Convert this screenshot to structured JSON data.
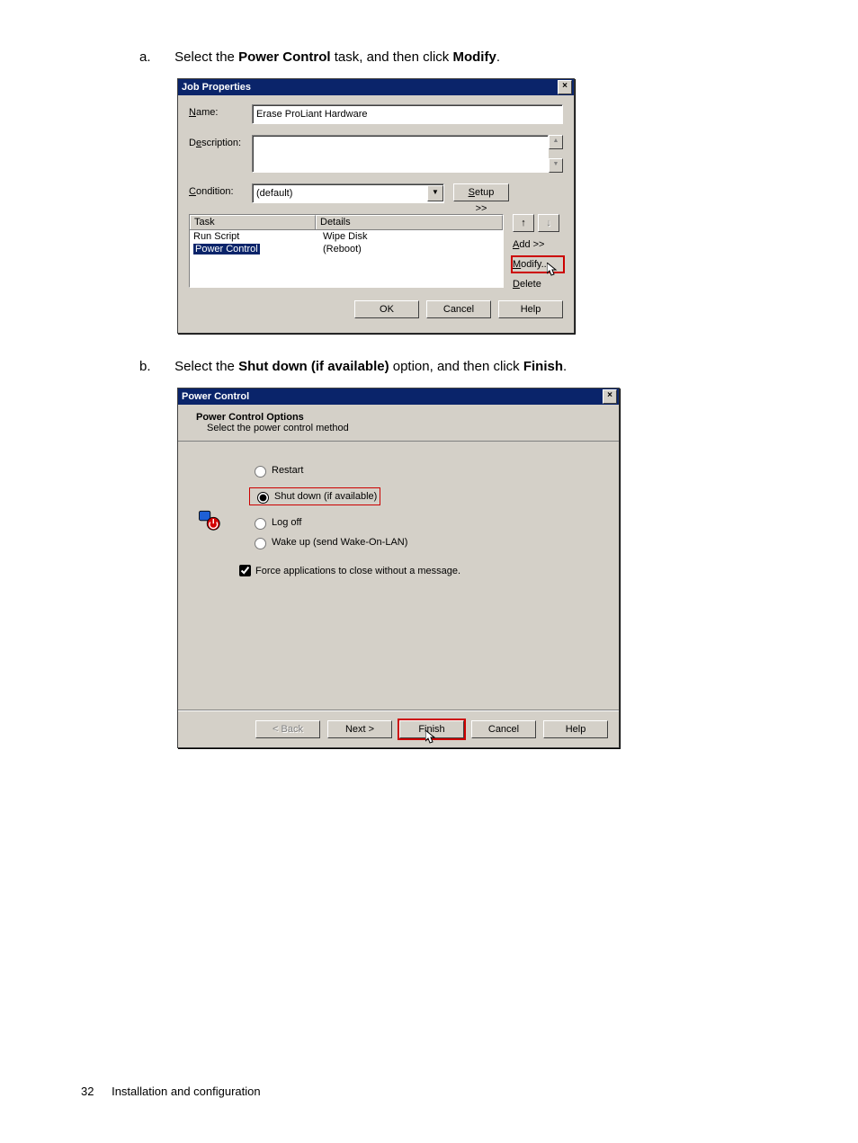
{
  "step_a": {
    "letter": "a.",
    "pre": "Select the ",
    "b1": "Power Control",
    "mid": " task, and then click ",
    "b2": "Modify",
    "post": "."
  },
  "step_b": {
    "letter": "b.",
    "pre": "Select the ",
    "b1": "Shut down (if available)",
    "mid": " option, and then click ",
    "b2": "Finish",
    "post": "."
  },
  "dlg1": {
    "title": "Job Properties",
    "name_label": "Name:",
    "name_value": "Erase ProLiant Hardware",
    "desc_label": "Description:",
    "cond_label": "Condition:",
    "cond_value": "(default)",
    "setup_btn": "Setup >>",
    "col_task": "Task",
    "col_details": "Details",
    "rows": [
      {
        "task": "Run Script",
        "details": "Wipe Disk"
      },
      {
        "task": "Power Control",
        "details": "(Reboot)"
      }
    ],
    "add_btn": "Add >>",
    "modify_btn": "Modify...",
    "delete_btn": "Delete",
    "ok": "OK",
    "cancel": "Cancel",
    "help": "Help"
  },
  "dlg2": {
    "title": "Power Control",
    "heading": "Power Control Options",
    "sub": "Select the power control method",
    "radios": {
      "restart": "Restart",
      "shutdown": "Shut down (if available)",
      "logoff": "Log off",
      "wol": "Wake up (send Wake-On-LAN)"
    },
    "force": "Force applications to close without a message.",
    "back": "< Back",
    "next": "Next >",
    "finish": "Finish",
    "cancel": "Cancel",
    "help": "Help"
  },
  "footer": {
    "page": "32",
    "section": "Installation and configuration"
  }
}
